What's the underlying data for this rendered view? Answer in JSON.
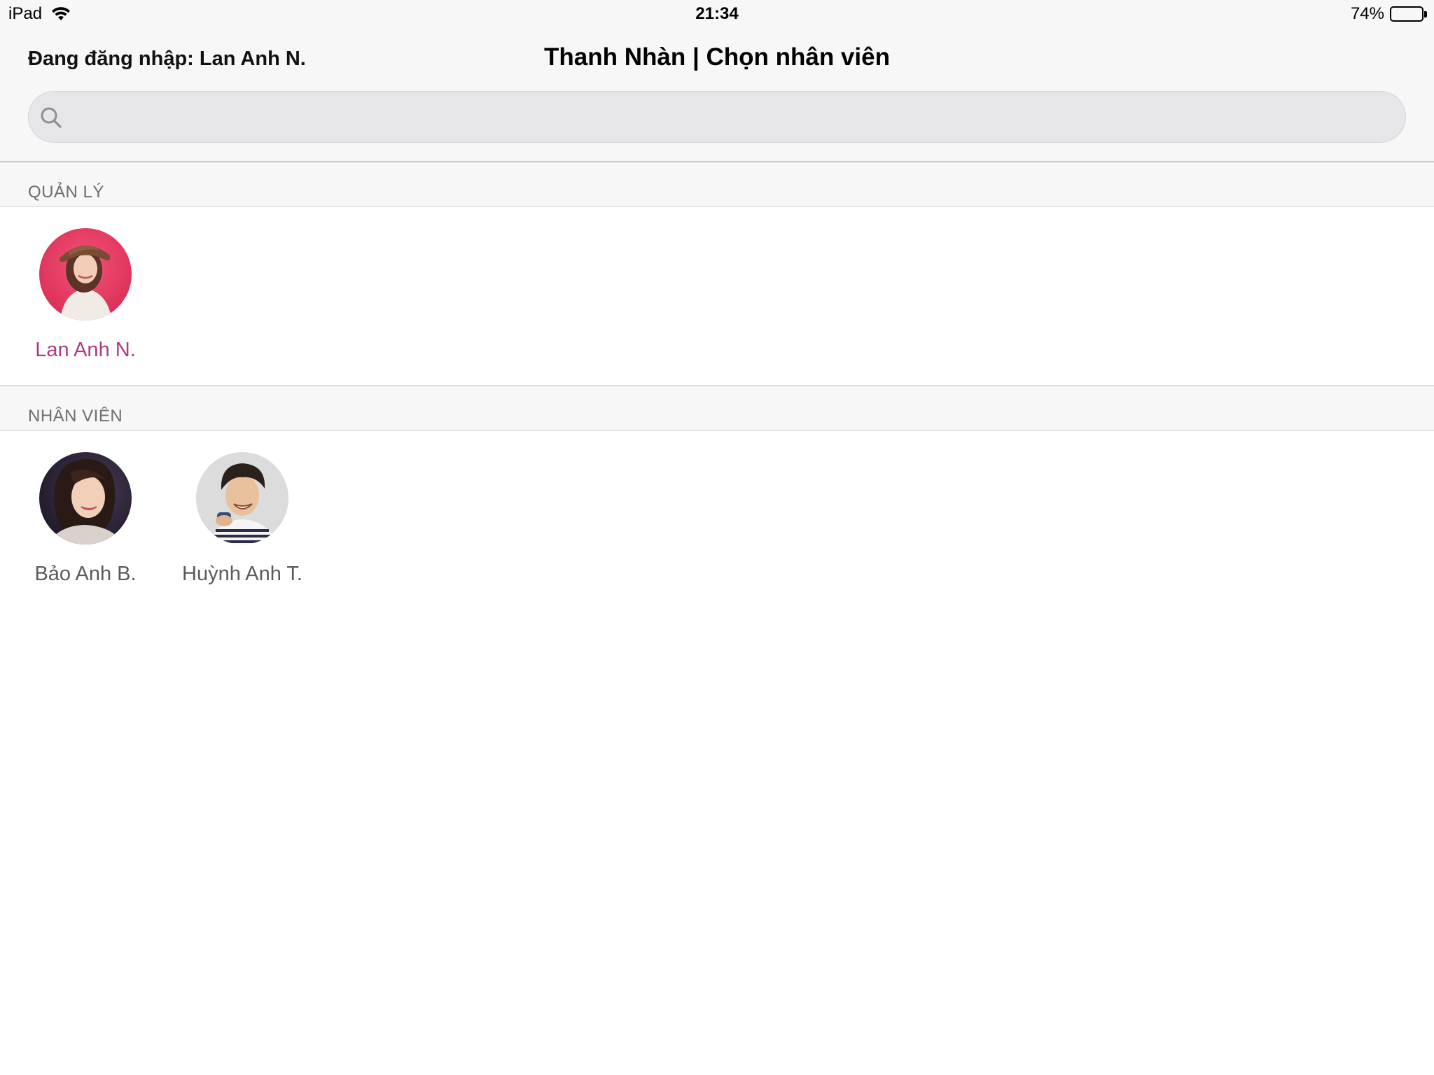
{
  "status_bar": {
    "device": "iPad",
    "time": "21:34",
    "battery_percent_label": "74%",
    "battery_level": 0.74
  },
  "header": {
    "login_label": "Đang đăng nhập: Lan Anh N.",
    "title": "Thanh Nhàn | Chọn nhân viên"
  },
  "search": {
    "placeholder": "",
    "value": ""
  },
  "sections": {
    "managers": {
      "title": "QUẢN LÝ",
      "members": [
        {
          "name": "Lan Anh N.",
          "selected": true
        }
      ]
    },
    "staff": {
      "title": "NHÂN VIÊN",
      "members": [
        {
          "name": "Bảo Anh B.",
          "selected": false
        },
        {
          "name": "Huỳnh Anh T.",
          "selected": false
        }
      ]
    }
  },
  "colors": {
    "selected_name": "#b03a82",
    "header_bg": "#f7f7f7",
    "search_bg": "#e6e6e9"
  }
}
